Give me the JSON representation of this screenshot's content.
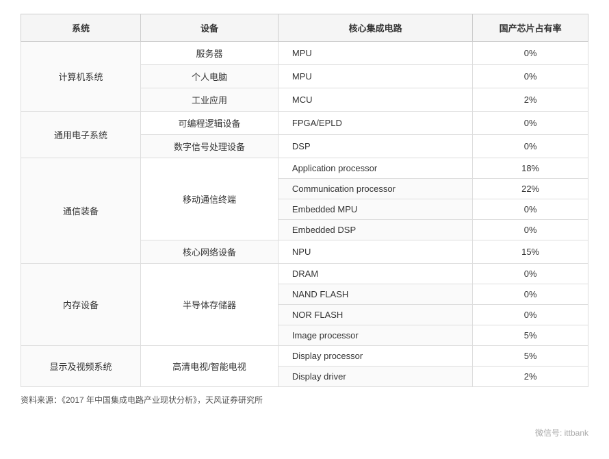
{
  "table": {
    "headers": [
      "系统",
      "设备",
      "核心集成电路",
      "国产芯片占有率"
    ],
    "rows": [
      {
        "system": "计算机系统",
        "device": "服务器",
        "chip": "MPU",
        "rate": "0%",
        "system_rowspan": 3,
        "device_rowspan": 1
      },
      {
        "system": "",
        "device": "个人电脑",
        "chip": "MPU",
        "rate": "0%",
        "system_rowspan": 0,
        "device_rowspan": 1
      },
      {
        "system": "",
        "device": "工业应用",
        "chip": "MCU",
        "rate": "2%",
        "system_rowspan": 0,
        "device_rowspan": 1
      },
      {
        "system": "通用电子系统",
        "device": "可编程逻辑设备",
        "chip": "FPGA/EPLD",
        "rate": "0%",
        "system_rowspan": 2,
        "device_rowspan": 1
      },
      {
        "system": "",
        "device": "数字信号处理设备",
        "chip": "DSP",
        "rate": "0%",
        "system_rowspan": 0,
        "device_rowspan": 1
      },
      {
        "system": "通信装备",
        "device": "移动通信终端",
        "chip": "Application processor",
        "rate": "18%",
        "system_rowspan": 5,
        "device_rowspan": 4
      },
      {
        "system": "",
        "device": "",
        "chip": "Communication processor",
        "rate": "22%",
        "system_rowspan": 0,
        "device_rowspan": 0
      },
      {
        "system": "",
        "device": "",
        "chip": "Embedded MPU",
        "rate": "0%",
        "system_rowspan": 0,
        "device_rowspan": 0
      },
      {
        "system": "",
        "device": "",
        "chip": "Embedded DSP",
        "rate": "0%",
        "system_rowspan": 0,
        "device_rowspan": 0
      },
      {
        "system": "",
        "device": "核心网络设备",
        "chip": "NPU",
        "rate": "15%",
        "system_rowspan": 0,
        "device_rowspan": 1
      },
      {
        "system": "内存设备",
        "device": "半导体存储器",
        "chip": "DRAM",
        "rate": "0%",
        "system_rowspan": 4,
        "device_rowspan": 4
      },
      {
        "system": "",
        "device": "",
        "chip": "NAND FLASH",
        "rate": "0%",
        "system_rowspan": 0,
        "device_rowspan": 0
      },
      {
        "system": "",
        "device": "",
        "chip": "NOR FLASH",
        "rate": "0%",
        "system_rowspan": 0,
        "device_rowspan": 0
      },
      {
        "system": "",
        "device": "",
        "chip": "Image processor",
        "rate": "5%",
        "system_rowspan": 0,
        "device_rowspan": 0
      },
      {
        "system": "显示及视频系统",
        "device": "高清电视/智能电视",
        "chip": "Display processor",
        "rate": "5%",
        "system_rowspan": 2,
        "device_rowspan": 2
      },
      {
        "system": "",
        "device": "",
        "chip": "Display driver",
        "rate": "2%",
        "system_rowspan": 0,
        "device_rowspan": 0
      }
    ]
  },
  "footnote": "资料来源：《2017 年中国集成电路产业现状分析》，天风证券研究所",
  "watermark": "微信号: ittbank"
}
